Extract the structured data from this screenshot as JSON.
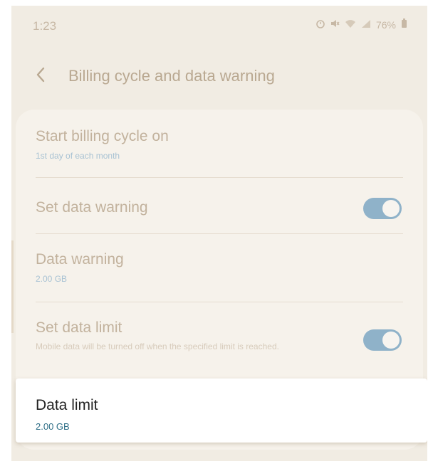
{
  "status_bar": {
    "time": "1:23",
    "battery": "76%",
    "icons": [
      "alarm-icon",
      "mute-icon",
      "wifi-icon",
      "signal-icon",
      "battery-icon"
    ]
  },
  "app_bar": {
    "title": "Billing cycle and data warning",
    "back_icon": "back-arrow-icon"
  },
  "settings": {
    "billing_cycle": {
      "title": "Start billing cycle on",
      "value": "1st day of each month"
    },
    "set_data_warning": {
      "title": "Set data warning",
      "enabled": true
    },
    "data_warning": {
      "title": "Data warning",
      "value": "2.00 GB"
    },
    "set_data_limit": {
      "title": "Set data limit",
      "description": "Mobile data will be turned off when the specified limit is reached.",
      "enabled": true
    },
    "data_limit": {
      "title": "Data limit",
      "value": "2.00 GB"
    }
  },
  "colors": {
    "background": "#f1ece3",
    "toggle_on": "#8fb2c9",
    "highlight_value": "#2f6f87"
  }
}
